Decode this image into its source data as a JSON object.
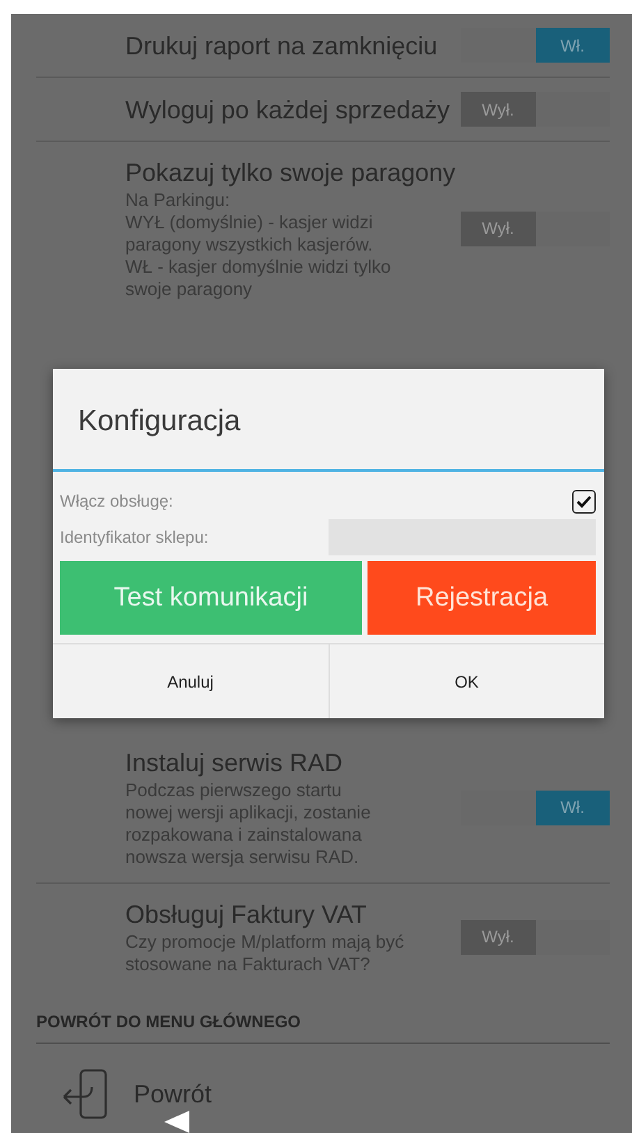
{
  "settings_top": [
    {
      "title": "Drukuj raport na zamknięciu",
      "toggle": {
        "on": true,
        "label": "Wł."
      }
    },
    {
      "title": "Wyloguj po każdej sprzedaży",
      "toggle": {
        "on": false,
        "label": "Wył."
      }
    },
    {
      "title": "Pokazuj tylko swoje paragony",
      "description": [
        "Na Parkingu:",
        "WYŁ (domyślnie) - kasjer widzi",
        "paragony wszystkich kasjerów.",
        "WŁ - kasjer domyślnie widzi tylko",
        "swoje paragony"
      ],
      "toggle": {
        "on": false,
        "label": "Wył."
      }
    }
  ],
  "settings_bottom": [
    {
      "title": "Instaluj serwis RAD",
      "description": [
        "Podczas pierwszego startu",
        "nowej wersji aplikacji, zostanie",
        "rozpakowana i zainstalowana",
        "nowsza wersja serwisu RAD."
      ],
      "toggle": {
        "on": true,
        "label": "Wł."
      }
    },
    {
      "title": "Obsługuj Faktury VAT",
      "description": [
        "Czy promocje M/platform mają być",
        "stosowane na Fakturach VAT?"
      ],
      "toggle": {
        "on": false,
        "label": "Wył."
      }
    }
  ],
  "section_header": "POWRÓT DO MENU GŁÓWNEGO",
  "back_item": {
    "label": "Powrót"
  },
  "dialog": {
    "title": "Konfiguracja",
    "enable": {
      "label": "Włącz obsługę:",
      "checked": true
    },
    "store_id": {
      "label": "Identyfikator sklepu:"
    },
    "action_buttons": [
      {
        "label": "Test komunikacji",
        "color": "#3dbf72"
      },
      {
        "label": "Rejestracja",
        "color": "#ff4a1c"
      }
    ],
    "buttons": [
      "Anuluj",
      "OK"
    ]
  }
}
